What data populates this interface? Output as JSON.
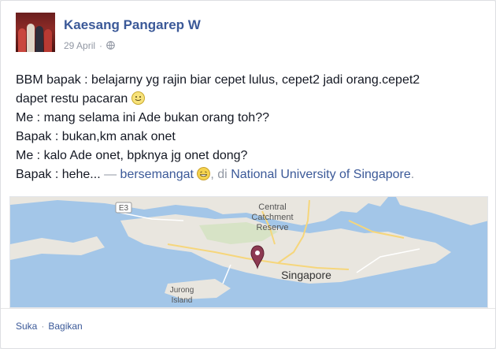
{
  "post": {
    "author": "Kaesang Pangarep W",
    "date": "29 April",
    "separator": "·",
    "privacy_icon": "globe-icon",
    "lines": [
      "BBM bapak : belajarny yg rajin biar cepet lulus, cepet2 jadi orang.cepet2",
      "dapet restu pacaran",
      "Me : mang selama ini Ade bukan orang toh??",
      "Bapak : bukan,km anak onet",
      "Me : kalo Ade onet, bpknya jg onet dong?",
      "Bapak : hehe..."
    ],
    "dash": "—",
    "feeling": "bersemangat",
    "location_prefix": ", di",
    "location": "National University of Singapore",
    "period": ".",
    "emoticons": [
      "smile-emoticon",
      "grin-emoticon"
    ]
  },
  "map": {
    "labels": {
      "highway": "E3",
      "reserve_1": "Central",
      "reserve_2": "Catchment",
      "reserve_3": "Reserve",
      "city": "Singapore",
      "island_1": "Jurong",
      "island_2": "Island"
    },
    "colors": {
      "water": "#a3c6e8",
      "land": "#e9e6df",
      "park": "#d7e3c6",
      "pin": "#8d3a52"
    }
  },
  "footer": {
    "like": "Suka",
    "separator": "·",
    "share": "Bagikan"
  },
  "colors": {
    "link": "#3b5998",
    "muted": "#9197a3",
    "text": "#141823"
  }
}
